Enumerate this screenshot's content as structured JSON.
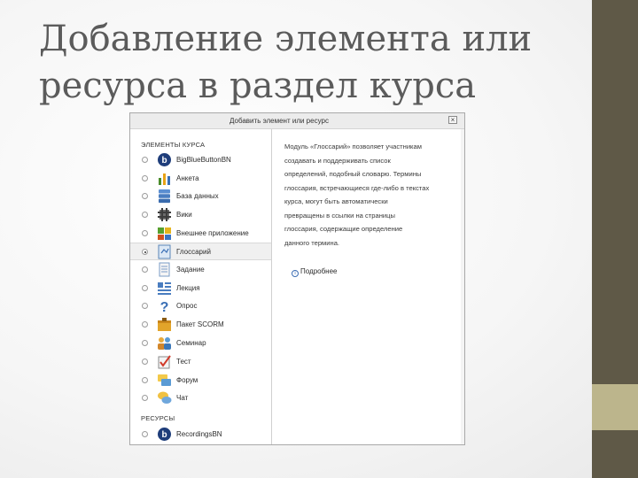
{
  "slide": {
    "title_line1": "Добавление элемента или",
    "title_line2": "ресурса в раздел курса"
  },
  "dialog": {
    "title": "Добавить элемент или ресурс",
    "close": "×"
  },
  "elements_section": {
    "header": "ЭЛЕМЕНТЫ КУРСА",
    "items": [
      {
        "label": "BigBlueButtonBN",
        "icon": "bigbluebutton-icon"
      },
      {
        "label": "Анкета",
        "icon": "chart-icon"
      },
      {
        "label": "База данных",
        "icon": "database-icon"
      },
      {
        "label": "Вики",
        "icon": "wiki-icon"
      },
      {
        "label": "Внешнее приложение",
        "icon": "puzzle-icon"
      },
      {
        "label": "Глоссарий",
        "icon": "glossary-icon",
        "selected": true
      },
      {
        "label": "Задание",
        "icon": "assignment-icon"
      },
      {
        "label": "Лекция",
        "icon": "lesson-icon"
      },
      {
        "label": "Опрос",
        "icon": "question-icon"
      },
      {
        "label": "Пакет SCORM",
        "icon": "scorm-package-icon"
      },
      {
        "label": "Семинар",
        "icon": "workshop-icon"
      },
      {
        "label": "Тест",
        "icon": "quiz-icon"
      },
      {
        "label": "Форум",
        "icon": "forum-icon"
      },
      {
        "label": "Чат",
        "icon": "chat-icon"
      }
    ]
  },
  "resources_section": {
    "header": "РЕСУРСЫ",
    "items": [
      {
        "label": "RecordingsBN",
        "icon": "recordings-icon"
      }
    ]
  },
  "description": {
    "lines": [
      "Модуль «Глоссарий» позволяет участникам",
      "создавать и поддерживать список",
      "определений, подобный словарю. Термины",
      "глоссария, встречающиеся где-либо в текстах",
      "курса, могут быть автоматически",
      "превращены в ссылки на страницы",
      "глоссария, содержащие определение",
      "данного термина."
    ],
    "more_label": "Подробнее",
    "more_icon": "info-icon"
  },
  "colors": {
    "sidebar_dark": "#5f5947",
    "sidebar_light": "#bcb58c",
    "title_text": "#5b5b5b"
  }
}
